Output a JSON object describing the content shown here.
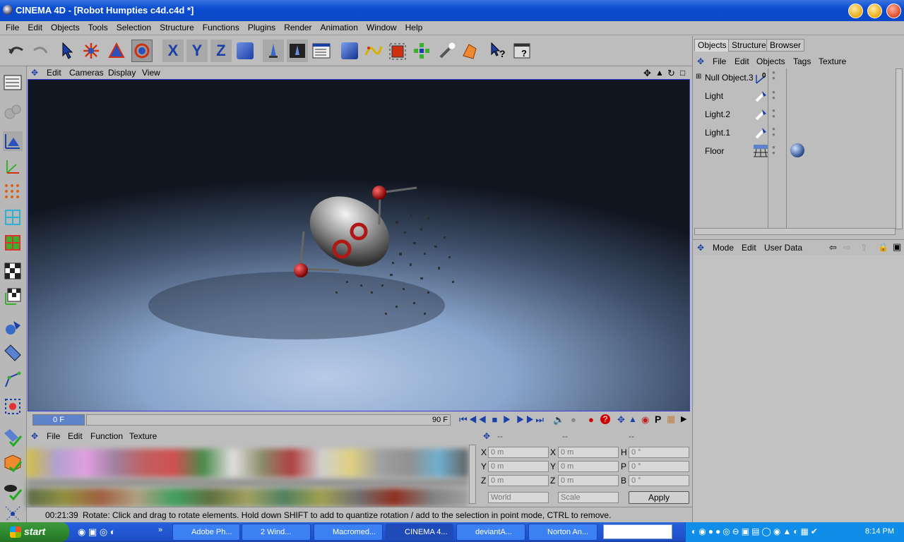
{
  "window": {
    "title": "CINEMA 4D - [Robot Humpties c4d.c4d *]"
  },
  "menu": [
    "File",
    "Edit",
    "Objects",
    "Tools",
    "Selection",
    "Structure",
    "Functions",
    "Plugins",
    "Render",
    "Animation",
    "Window",
    "Help"
  ],
  "viewport_menu": [
    "Edit",
    "Cameras",
    "Display",
    "View"
  ],
  "timeline": {
    "current_frame": "0 F",
    "end_frame": "90 F"
  },
  "material_menu": [
    "File",
    "Edit",
    "Function",
    "Texture"
  ],
  "coords": {
    "rows": [
      {
        "a": "X",
        "av": "0 m",
        "b": "X",
        "bv": "0 m",
        "c": "H",
        "cv": "0 °"
      },
      {
        "a": "Y",
        "av": "0 m",
        "b": "Y",
        "bv": "0 m",
        "c": "P",
        "cv": "0 °"
      },
      {
        "a": "Z",
        "av": "0 m",
        "b": "Z",
        "bv": "0 m",
        "c": "B",
        "cv": "0 °"
      }
    ],
    "header_a": "--",
    "header_b": "--",
    "header_c": "--",
    "mode": "World",
    "transform": "Scale",
    "apply": "Apply"
  },
  "status": {
    "time": "00:21:39",
    "text": "Rotate: Click and drag to rotate elements. Hold down SHIFT to add to quantize rotation / add to the selection in point mode, CTRL to remove."
  },
  "tabs": [
    "Objects",
    "Structure",
    "Browser"
  ],
  "object_menu": [
    "File",
    "Edit",
    "Objects",
    "Tags",
    "Texture"
  ],
  "objects": [
    "Null Object.3",
    "Light",
    "Light.2",
    "Light.1",
    "Floor"
  ],
  "attr_menu": [
    "Mode",
    "Edit",
    "User Data"
  ],
  "taskbar": {
    "start": "start",
    "tasks": [
      "Adobe Ph...",
      "2 Wind...",
      "Macromed...",
      "CINEMA 4...",
      "deviantA...",
      "Norton An..."
    ],
    "clock": "8:14 PM"
  },
  "colors": {
    "accent": "#5e83c9",
    "viewport_border": "#3c3cd6",
    "taskbar": "#245edb"
  }
}
